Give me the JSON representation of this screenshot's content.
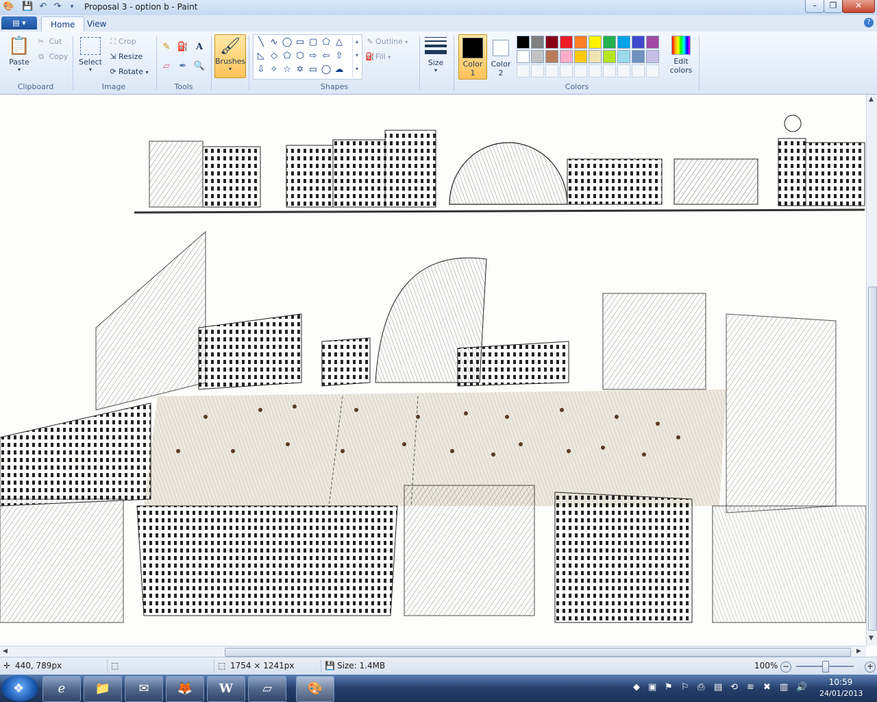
{
  "window": {
    "title": "Proposal 3 - option b - Paint",
    "controls": {
      "minimize": "–",
      "maximize": "❐",
      "close": "✕"
    }
  },
  "tabs": {
    "app_menu": "▤ ▾",
    "home": "Home",
    "view": "View",
    "help": "?"
  },
  "ribbon": {
    "clipboard": {
      "paste": "Paste",
      "cut": "Cut",
      "copy": "Copy",
      "label": "Clipboard"
    },
    "image": {
      "select": "Select",
      "crop": "Crop",
      "resize": "Resize",
      "rotate": "Rotate",
      "label": "Image"
    },
    "tools": {
      "label": "Tools",
      "text_tool": "A"
    },
    "brushes": {
      "label": "Brushes"
    },
    "shapes": {
      "outline": "Outline",
      "fill": "Fill",
      "label": "Shapes"
    },
    "size": {
      "label": "Size"
    },
    "color1": {
      "line1": "Color",
      "line2": "1"
    },
    "color2": {
      "line1": "Color",
      "line2": "2"
    },
    "colors": {
      "label": "Colors",
      "edit_line1": "Edit",
      "edit_line2": "colors"
    },
    "palette_row1": [
      "#000000",
      "#7f7f7f",
      "#880015",
      "#ed1c24",
      "#ff7f27",
      "#fff200",
      "#22b14c",
      "#00a2e8",
      "#3f48cc",
      "#a349a4"
    ],
    "palette_row2": [
      "#ffffff",
      "#c3c3c3",
      "#b97a57",
      "#ffaec9",
      "#ffc90e",
      "#efe4b0",
      "#b5e61d",
      "#99d9ea",
      "#7092be",
      "#c8bfe7"
    ],
    "color1_value": "#000000",
    "color2_value": "#ffffff"
  },
  "status": {
    "cursor": "440, 789px",
    "canvas_size": "1754 × 1241px",
    "file_size": "Size: 1.4MB",
    "zoom": "100%",
    "zoom_level": 1.0
  },
  "taskbar": {
    "apps": [
      "Internet Explorer",
      "Windows Explorer",
      "Outlook",
      "Firefox",
      "Word",
      "Notepad",
      "Paint"
    ],
    "time": "10:59",
    "date": "24/01/2013"
  }
}
